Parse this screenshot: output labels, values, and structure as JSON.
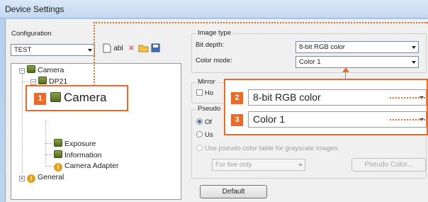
{
  "window": {
    "title": "Device Settings"
  },
  "configuration": {
    "label": "Configuration",
    "selected": "TEST"
  },
  "toolbar": {
    "rename_label": "abl"
  },
  "tree": {
    "camera_label": "Camera",
    "dp21_label": "DP21",
    "exposure_label": "Exposure",
    "information_label": "Information",
    "camera_adapter_label": "Camera Adapter",
    "general_label": "General"
  },
  "image_type": {
    "group_title": "Image type",
    "bit_depth_label": "Bit depth:",
    "bit_depth_value": "8-bit RGB color",
    "color_mode_label": "Color mode:",
    "color_mode_value": "Color 1"
  },
  "mirror": {
    "group_title": "Mirror",
    "horizontal_label": "Ho"
  },
  "pseudo": {
    "group_title": "Pseudo",
    "off_label": "Of",
    "use_label": "Us",
    "grayscale_label": "Use pseudo color table for grayscale images",
    "live_only_value": "For live only",
    "pseudo_color_button": "Pseudo Color..."
  },
  "default_button": "Default",
  "callouts": {
    "c1": {
      "number": "1",
      "text": "Camera"
    },
    "c2": {
      "number": "2",
      "text": "8-bit RGB color"
    },
    "c3": {
      "number": "3",
      "text": "Color 1"
    }
  },
  "colors": {
    "accent": "#e96a2a",
    "titlebar": "#c3d8f1"
  },
  "icons": [
    "camera-icon",
    "warning-icon",
    "new-icon",
    "delete-icon",
    "open-folder-icon",
    "save-icon"
  ]
}
